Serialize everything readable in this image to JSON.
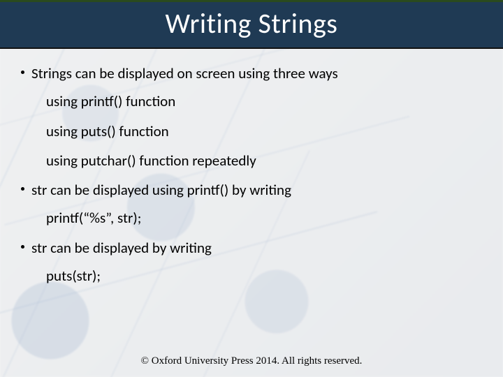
{
  "title": "Writing Strings",
  "bullets": {
    "b1": "Strings can be displayed on screen using three ways",
    "s1": "using printf() function",
    "s2": "using puts() function",
    "s3": "using putchar() function repeatedly",
    "b2": "str can be displayed using printf() by writing",
    "s4": "printf(“%s”, str);",
    "b3": "str can be displayed by writing",
    "s5": "puts(str);"
  },
  "footer": "© Oxford University Press 2014. All rights reserved."
}
